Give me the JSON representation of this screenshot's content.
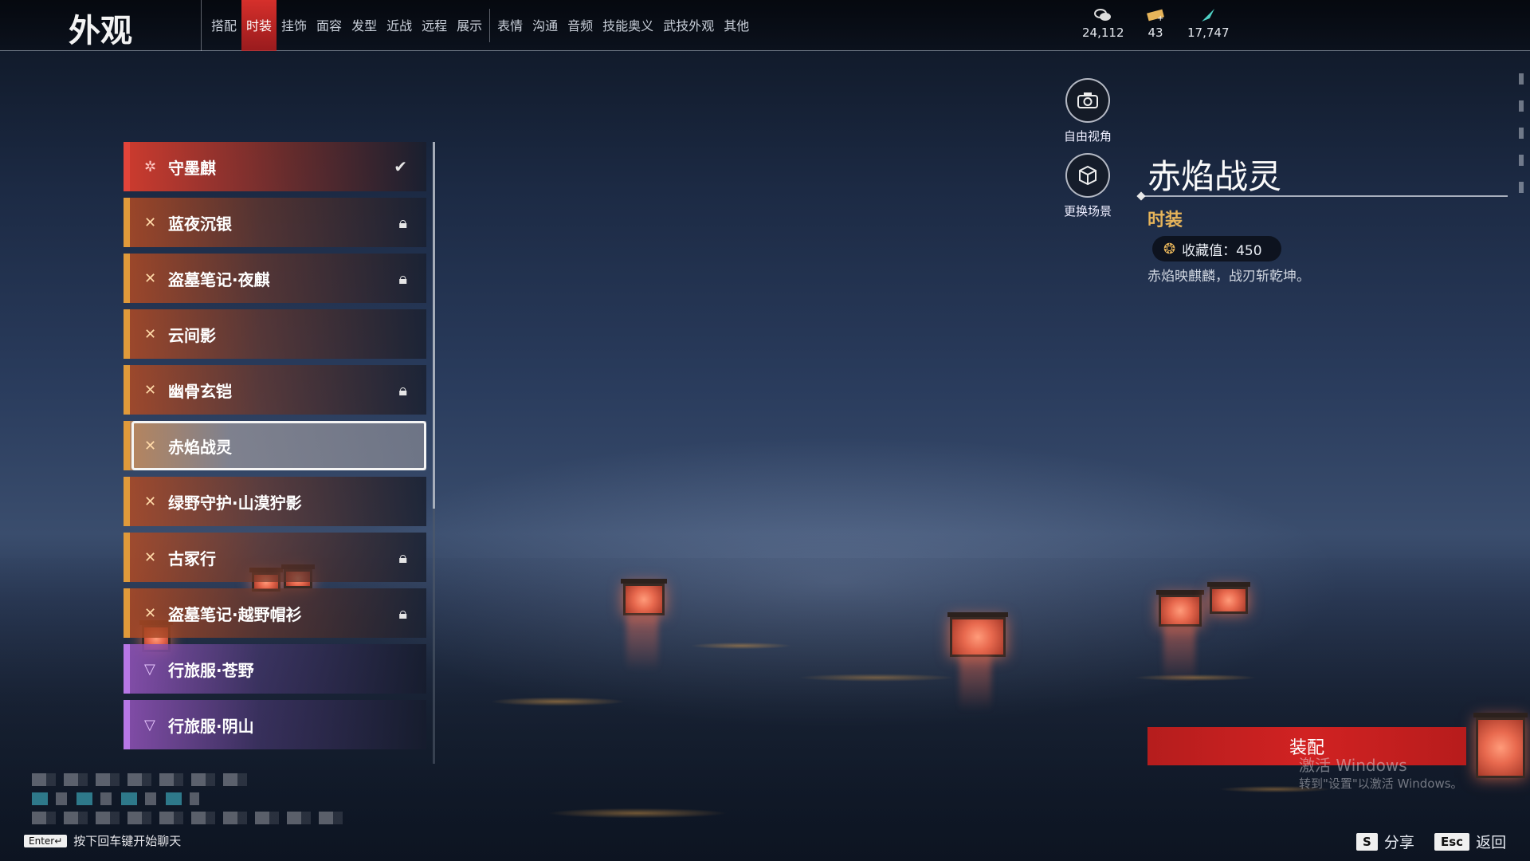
{
  "header": {
    "title": "外观",
    "tabs": [
      "搭配",
      "时装",
      "挂饰",
      "面容",
      "发型",
      "近战",
      "远程",
      "展示",
      "表情",
      "沟通",
      "音频",
      "技能奥义",
      "武技外观",
      "其他"
    ],
    "active_tab": "时装"
  },
  "currencies": [
    {
      "icon": "coin-stack-icon",
      "value": "24,112"
    },
    {
      "icon": "ticket-icon",
      "value": "43"
    },
    {
      "icon": "feather-icon",
      "value": "17,747"
    }
  ],
  "costumes": [
    {
      "name": "守墨麒",
      "tier": "red",
      "mark": "check"
    },
    {
      "name": "蓝夜沉银",
      "tier": "orange",
      "mark": "lock"
    },
    {
      "name": "盗墓笔记·夜麒",
      "tier": "orange",
      "mark": "lock"
    },
    {
      "name": "云间影",
      "tier": "orange",
      "mark": ""
    },
    {
      "name": "幽骨玄铠",
      "tier": "orange",
      "mark": "lock"
    },
    {
      "name": "赤焰战灵",
      "tier": "orange",
      "mark": "",
      "selected": true
    },
    {
      "name": "绿野守护·山漠狞影",
      "tier": "orange",
      "mark": ""
    },
    {
      "name": "古冢行",
      "tier": "orange",
      "mark": "lock"
    },
    {
      "name": "盗墓笔记·越野帽衫",
      "tier": "orange",
      "mark": "lock"
    },
    {
      "name": "行旅服·苍野",
      "tier": "purple",
      "mark": ""
    },
    {
      "name": "行旅服·阴山",
      "tier": "purple",
      "mark": ""
    }
  ],
  "camera": {
    "free_view_label": "自由视角",
    "change_scene_label": "更换场景"
  },
  "detail": {
    "title": "赤焰战灵",
    "category": "时装",
    "collection_label": "收藏值：450",
    "description": "赤焰映麒麟，战刃斩乾坤。"
  },
  "equip_label": "装配",
  "watermark": {
    "line1": "激活 Windows",
    "line2": "转到\"设置\"以激活 Windows。"
  },
  "chat": {
    "key": "Enter↵",
    "hint": "按下回车键开始聊天"
  },
  "bottom_actions": {
    "share_key": "S",
    "share_label": "分享",
    "back_key": "Esc",
    "back_label": "返回"
  },
  "colors": {
    "accent_red": "#d12222",
    "tier_orange": "#e09a3a",
    "tier_red": "#e2443a",
    "tier_purple": "#b777e6",
    "category_gold": "#e6b45a"
  }
}
